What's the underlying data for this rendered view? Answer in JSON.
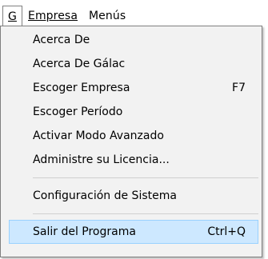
{
  "menubar": {
    "items": [
      {
        "label": "G"
      },
      {
        "label": "Empresa"
      },
      {
        "label": "Menús"
      }
    ]
  },
  "dropdown": {
    "items": [
      {
        "label": "Acerca De",
        "shortcut": ""
      },
      {
        "label": "Acerca De Gálac",
        "shortcut": ""
      },
      {
        "label": "Escoger Empresa",
        "shortcut": "F7"
      },
      {
        "label": "Escoger Período",
        "shortcut": ""
      },
      {
        "label": "Activar Modo Avanzado",
        "shortcut": ""
      },
      {
        "label": "Administre su Licencia...",
        "shortcut": ""
      },
      {
        "label": "Configuración de Sistema",
        "shortcut": ""
      },
      {
        "label": "Salir del Programa",
        "shortcut": "Ctrl+Q"
      }
    ],
    "highlighted_item": "Salir del Programa"
  },
  "colors": {
    "menu_background": "#f2f2f2",
    "hover_background": "#cde8ff",
    "hover_border": "#99d1ff",
    "border": "#808080"
  }
}
